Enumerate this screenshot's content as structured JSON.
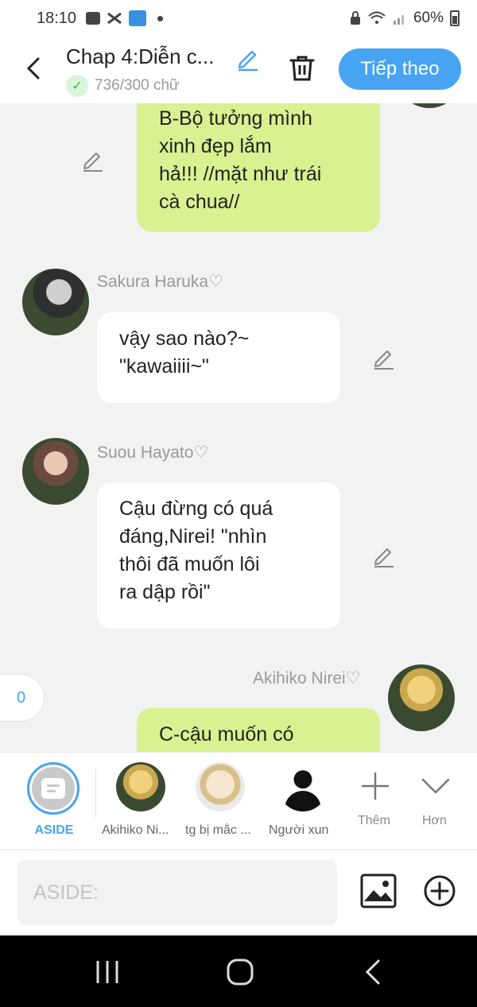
{
  "status_bar": {
    "time": "18:10",
    "battery": "60%"
  },
  "header": {
    "title": "Chap 4:Diễn c...",
    "word_count": "736/300 chữ",
    "next_button": "Tiếp theo"
  },
  "messages": [
    {
      "side": "right",
      "lines": [
        "B-Bộ tưởng mình",
        "xinh đẹp lắm",
        "hả!!! //mặt như trái",
        "cà chua//"
      ]
    },
    {
      "side": "left",
      "speaker": "Sakura Haruka♡",
      "lines": [
        "vậy sao nào?~",
        "\"kawaiiii~\""
      ]
    },
    {
      "side": "left",
      "speaker": "Suou Hayato♡",
      "lines": [
        "Cậu đừng có quá",
        "đáng,Nirei! \"nhìn",
        "thôi đã muốn lôi",
        "ra dập rồi\""
      ]
    },
    {
      "side": "right",
      "speaker": "Akihiko Nirei♡",
      "lines": [
        "C-cậu muốn có"
      ]
    }
  ],
  "unread_counter": "0",
  "characters": {
    "aside": "ASIDE",
    "items": [
      "Akihiko Ni...",
      "tg bị mắc ...",
      "Người xun"
    ],
    "add_label": "Thêm",
    "more_label": "Hơn"
  },
  "input": {
    "placeholder": "ASIDE:"
  },
  "colors": {
    "accent": "#47a4f2",
    "my_bubble": "#d9f190",
    "background": "#f2f2f2"
  }
}
